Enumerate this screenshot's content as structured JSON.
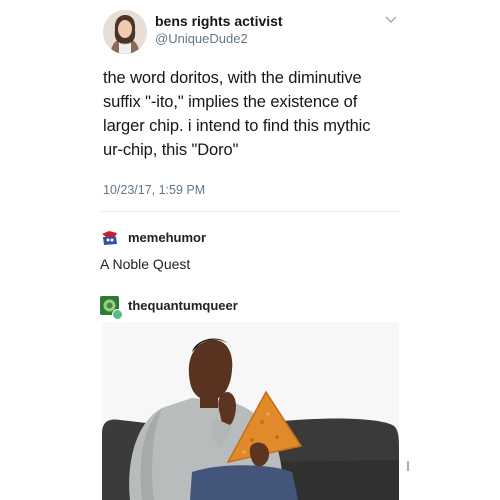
{
  "tweet": {
    "display_name": "bens rights activist",
    "handle": "@UniqueDude2",
    "lines": [
      "the word doritos, with the diminutive",
      "suffix \"-ito,\" implies the existence of",
      "larger chip. i intend to find this mythic",
      "ur-chip, this \"Doro\""
    ],
    "timestamp": "10/23/17, 1:59 PM",
    "menu_icon": "chevron-down-icon"
  },
  "reblogs": [
    {
      "username": "memehumor",
      "text": "A Noble Quest",
      "avatar_icon": "memehumor-avatar"
    },
    {
      "username": "thequantumqueer",
      "avatar_icon": "thequantumqueer-avatar",
      "badge_icon": "refresh-badge-icon"
    }
  ],
  "colors": {
    "handle": "#657786",
    "divider": "#e6ecf0",
    "badge": "#56bc8a",
    "chip": "#e08a2c",
    "sofa": "#3a3a38"
  }
}
